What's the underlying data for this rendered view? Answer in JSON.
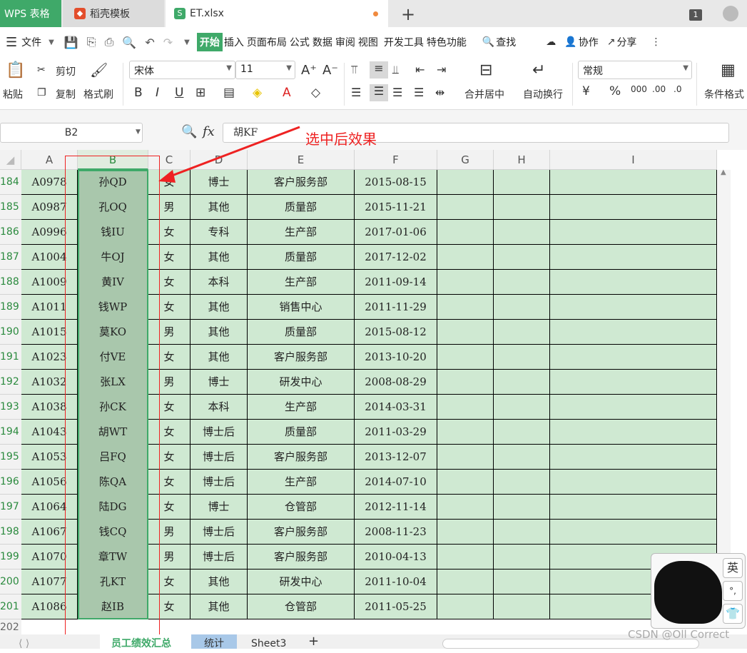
{
  "tabs": {
    "app": "WPS 表格",
    "template": "稻壳模板",
    "file": "ET.xlsx",
    "count": "1"
  },
  "menu": [
    "文件",
    "开始",
    "插入",
    "页面布局",
    "公式",
    "数据",
    "审阅",
    "视图",
    "开发工具",
    "特色功能",
    "查找",
    "协作",
    "分享"
  ],
  "ribbon": {
    "paste": "粘贴",
    "cut": "剪切",
    "copy": "复制",
    "format_painter": "格式刷",
    "font": "宋体",
    "size": "11",
    "bold": "B",
    "italic": "I",
    "underline": "U",
    "merge": "合并居中",
    "wrap": "自动换行",
    "number_format": "常规",
    "cond_format": "条件格式"
  },
  "formula_bar": {
    "cell_ref": "B2",
    "fx": "fx",
    "value": "胡KF"
  },
  "annotation": "选中后效果",
  "columns": [
    "A",
    "B",
    "C",
    "D",
    "E",
    "F",
    "G",
    "H",
    "I"
  ],
  "rows": [
    {
      "n": "184",
      "a": "A0978",
      "b": "孙QD",
      "c": "女",
      "d": "博士",
      "e": "客户服务部",
      "f": "2015-08-15"
    },
    {
      "n": "185",
      "a": "A0987",
      "b": "孔OQ",
      "c": "男",
      "d": "其他",
      "e": "质量部",
      "f": "2015-11-21"
    },
    {
      "n": "186",
      "a": "A0996",
      "b": "钱IU",
      "c": "女",
      "d": "专科",
      "e": "生产部",
      "f": "2017-01-06"
    },
    {
      "n": "187",
      "a": "A1004",
      "b": "牛OJ",
      "c": "女",
      "d": "其他",
      "e": "质量部",
      "f": "2017-12-02"
    },
    {
      "n": "188",
      "a": "A1009",
      "b": "黄IV",
      "c": "女",
      "d": "本科",
      "e": "生产部",
      "f": "2011-09-14"
    },
    {
      "n": "189",
      "a": "A1011",
      "b": "钱WP",
      "c": "女",
      "d": "其他",
      "e": "销售中心",
      "f": "2011-11-29"
    },
    {
      "n": "190",
      "a": "A1015",
      "b": "莫KO",
      "c": "男",
      "d": "其他",
      "e": "质量部",
      "f": "2015-08-12"
    },
    {
      "n": "191",
      "a": "A1023",
      "b": "付VE",
      "c": "女",
      "d": "其他",
      "e": "客户服务部",
      "f": "2013-10-20"
    },
    {
      "n": "192",
      "a": "A1032",
      "b": "张LX",
      "c": "男",
      "d": "博士",
      "e": "研发中心",
      "f": "2008-08-29"
    },
    {
      "n": "193",
      "a": "A1038",
      "b": "孙CK",
      "c": "女",
      "d": "本科",
      "e": "生产部",
      "f": "2014-03-31"
    },
    {
      "n": "194",
      "a": "A1043",
      "b": "胡WT",
      "c": "女",
      "d": "博士后",
      "e": "质量部",
      "f": "2011-03-29"
    },
    {
      "n": "195",
      "a": "A1053",
      "b": "吕FQ",
      "c": "女",
      "d": "博士后",
      "e": "客户服务部",
      "f": "2013-12-07"
    },
    {
      "n": "196",
      "a": "A1056",
      "b": "陈QA",
      "c": "女",
      "d": "博士后",
      "e": "生产部",
      "f": "2014-07-10"
    },
    {
      "n": "197",
      "a": "A1064",
      "b": "陆DG",
      "c": "女",
      "d": "博士",
      "e": "仓管部",
      "f": "2012-11-14"
    },
    {
      "n": "198",
      "a": "A1067",
      "b": "钱CQ",
      "c": "男",
      "d": "博士后",
      "e": "客户服务部",
      "f": "2008-11-23"
    },
    {
      "n": "199",
      "a": "A1070",
      "b": "章TW",
      "c": "男",
      "d": "博士后",
      "e": "客户服务部",
      "f": "2010-04-13"
    },
    {
      "n": "200",
      "a": "A1077",
      "b": "孔KT",
      "c": "女",
      "d": "其他",
      "e": "研发中心",
      "f": "2011-10-04"
    },
    {
      "n": "201",
      "a": "A1086",
      "b": "赵IB",
      "c": "女",
      "d": "其他",
      "e": "仓管部",
      "f": "2011-05-25"
    }
  ],
  "next_row": "202",
  "sheets": [
    "员工绩效汇总",
    "统计",
    "Sheet3"
  ],
  "ime": {
    "lang": "英",
    "punct": "°,",
    "skin": "skin-icon"
  },
  "watermark": "CSDN @Oll Correct"
}
